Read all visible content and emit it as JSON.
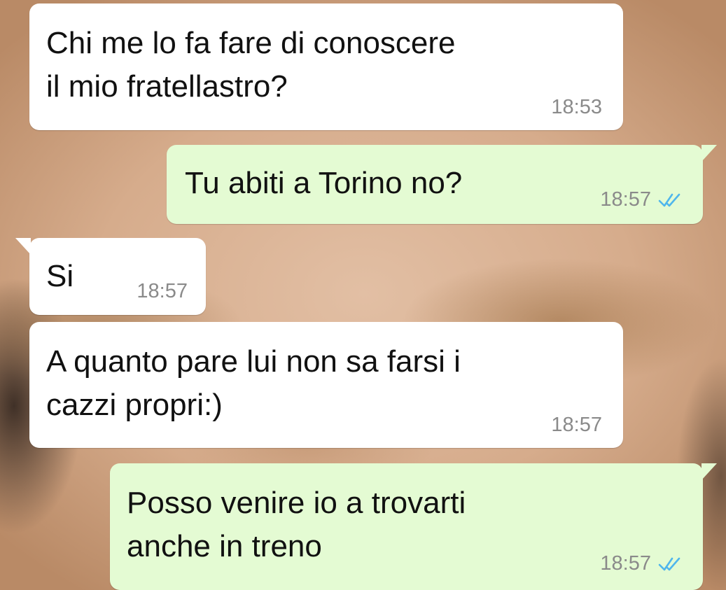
{
  "colors": {
    "incoming_bubble": "#ffffff",
    "outgoing_bubble": "#e4fbd3",
    "timestamp": "#8a8a8a",
    "read_ticks": "#4fb6ec"
  },
  "messages": [
    {
      "direction": "incoming",
      "text": "Chi me lo fa fare di conoscere\nil mio fratellastro?",
      "time": "18:53",
      "status_icon": null
    },
    {
      "direction": "outgoing",
      "text": "Tu abiti a Torino no?",
      "time": "18:57",
      "status_icon": "double-check-read-icon"
    },
    {
      "direction": "incoming",
      "text": "Si",
      "time": "18:57",
      "status_icon": null
    },
    {
      "direction": "incoming",
      "text": "A quanto pare lui non sa farsi i\ncazzi propri:)",
      "time": "18:57",
      "status_icon": null
    },
    {
      "direction": "outgoing",
      "text": "Posso venire io a trovarti\nanche in treno",
      "time": "18:57",
      "status_icon": "double-check-read-icon"
    }
  ]
}
